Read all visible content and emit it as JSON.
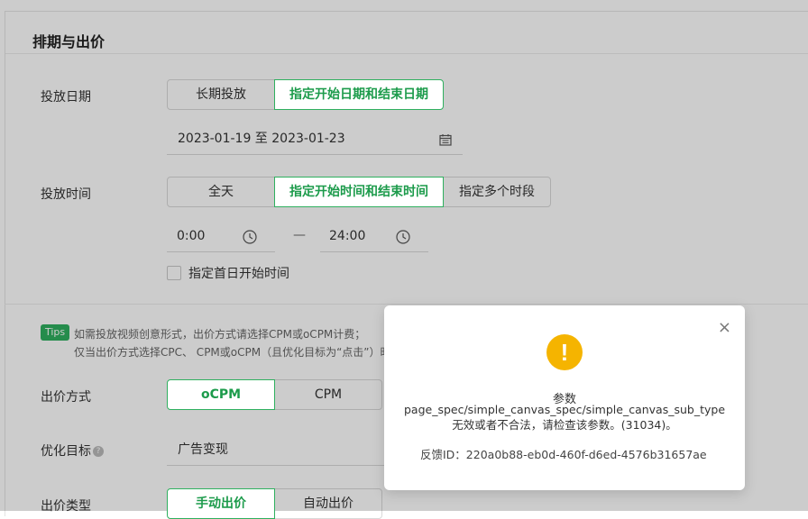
{
  "section": {
    "title": "排期与出价"
  },
  "delivery_date": {
    "label": "投放日期",
    "options": [
      "长期投放",
      "指定开始日期和结束日期"
    ],
    "range_value": "2023-01-19 至 2023-01-23",
    "calendar_icon": "calendar-icon"
  },
  "delivery_time": {
    "label": "投放时间",
    "options": [
      "全天",
      "指定开始时间和结束时间",
      "指定多个时段"
    ],
    "start": "0:00",
    "separator": "—",
    "end": "24:00",
    "clock_icon": "clock-icon",
    "first_day_checkbox": "指定首日开始时间"
  },
  "tips": {
    "badge": "Tips",
    "line1": "如需投放视频创意形式，出价方式请选择CPM或oCPM计费；",
    "line2": "仅当出价方式选择CPC、 CPM或oCPM（且优化目标为“点击”）时"
  },
  "bid_method": {
    "label": "出价方式",
    "options": [
      "oCPM",
      "CPM"
    ]
  },
  "optimization_goal": {
    "label": "优化目标",
    "help": "?",
    "value": "广告变现"
  },
  "bid_type": {
    "label": "出价类型",
    "options": [
      "手动出价",
      "自动出价"
    ]
  },
  "dialog": {
    "icon": "!",
    "title": "参数",
    "line1": "page_spec/simple_canvas_spec/simple_canvas_sub_type",
    "line2": "无效或者不合法，请检查该参数。(31034)。",
    "feedback": "反馈ID：220a0b88-eb0d-460f-d6ed-4576b31657ae",
    "close": "×"
  },
  "colors": {
    "accent": "#2fb05f",
    "warning": "#f5b400"
  }
}
